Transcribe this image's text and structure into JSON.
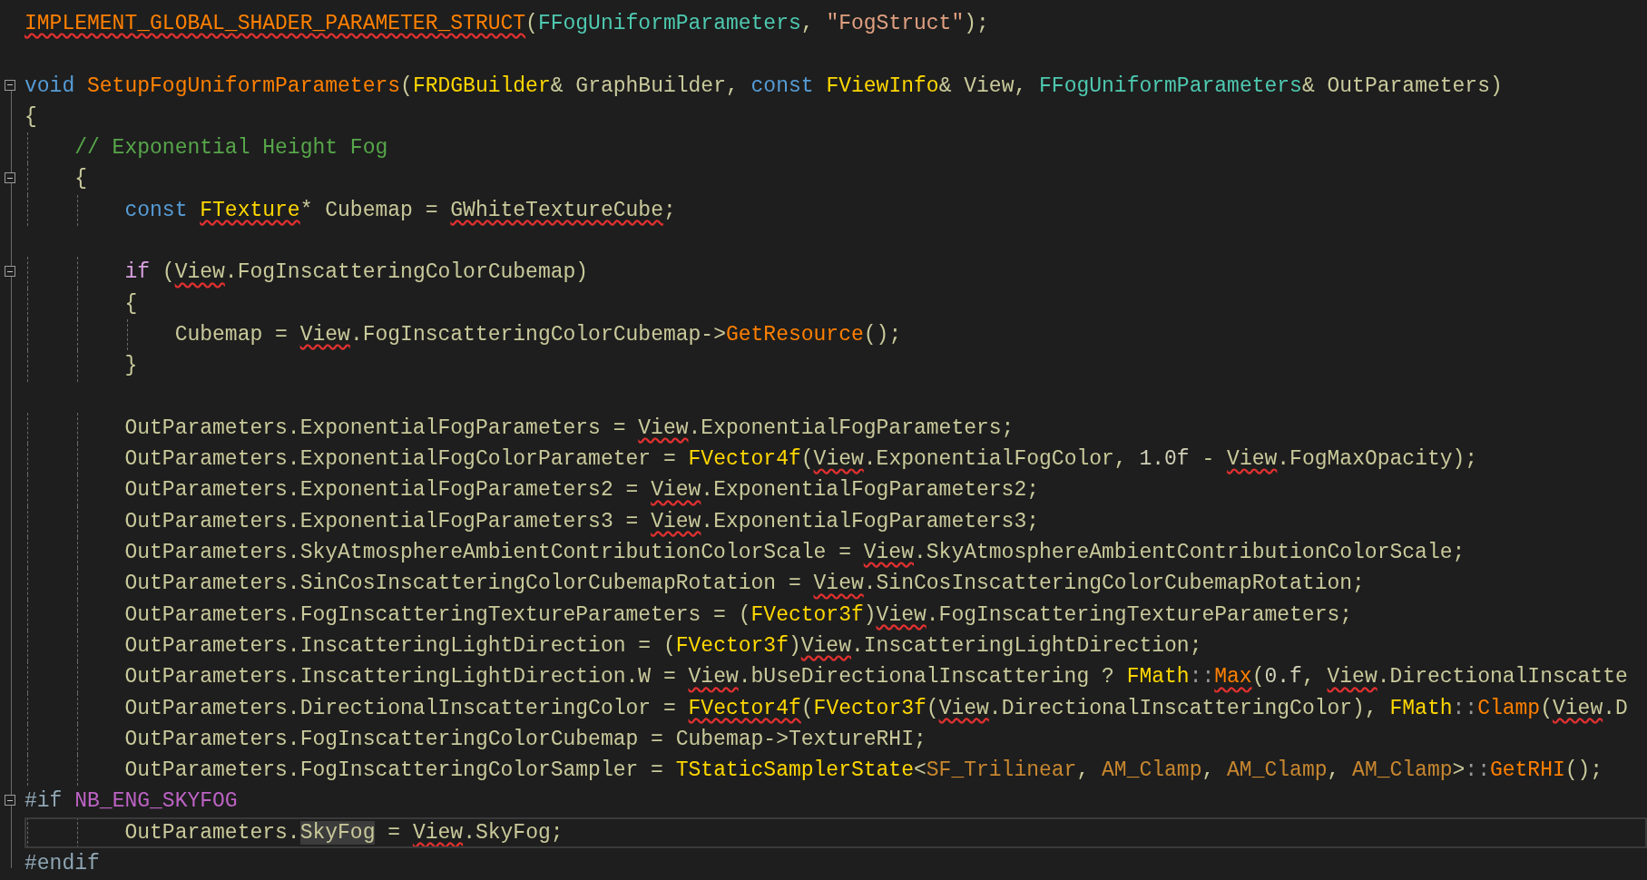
{
  "editor": {
    "lines": [
      {
        "fold": false,
        "current": false,
        "tokens": [
          {
            "text": "IMPLEMENT_GLOBAL_SHADER_PARAMETER_STRUCT",
            "kind": "fn",
            "squiggle": true,
            "highlighted": false
          },
          {
            "text": "(",
            "kind": "id",
            "squiggle": false,
            "highlighted": false
          },
          {
            "text": "FFogUniformParameters",
            "kind": "cls",
            "squiggle": false,
            "highlighted": false
          },
          {
            "text": ", ",
            "kind": "id",
            "squiggle": false,
            "highlighted": false
          },
          {
            "text": "\"FogStruct\"",
            "kind": "str",
            "squiggle": false,
            "highlighted": false
          },
          {
            "text": ");",
            "kind": "id",
            "squiggle": false,
            "highlighted": false
          }
        ]
      },
      {
        "fold": false,
        "current": false
      },
      {
        "fold": true,
        "current": false,
        "tokens": [
          {
            "text": "void ",
            "kind": "kw",
            "squiggle": false,
            "highlighted": false
          },
          {
            "text": "SetupFogUniformParameters",
            "kind": "fn",
            "squiggle": false,
            "highlighted": false
          },
          {
            "text": "(",
            "kind": "id",
            "squiggle": false,
            "highlighted": false
          },
          {
            "text": "FRDGBuilder",
            "kind": "type",
            "squiggle": false,
            "highlighted": false
          },
          {
            "text": "& GraphBuilder, ",
            "kind": "id",
            "squiggle": false,
            "highlighted": false
          },
          {
            "text": "const ",
            "kind": "kw",
            "squiggle": false,
            "highlighted": false
          },
          {
            "text": "FViewInfo",
            "kind": "type",
            "squiggle": false,
            "highlighted": false
          },
          {
            "text": "& View, ",
            "kind": "id",
            "squiggle": false,
            "highlighted": false
          },
          {
            "text": "FFogUniformParameters",
            "kind": "cls",
            "squiggle": false,
            "highlighted": false
          },
          {
            "text": "& OutParameters)",
            "kind": "id",
            "squiggle": false,
            "highlighted": false
          }
        ]
      },
      {
        "fold": false,
        "current": false,
        "tokens": [
          {
            "text": "{",
            "kind": "id",
            "squiggle": false,
            "highlighted": false
          }
        ]
      },
      {
        "fold": false,
        "current": false,
        "tokens": [
          {
            "text": "    // Exponential Height Fog",
            "kind": "cmt",
            "squiggle": false,
            "highlighted": false
          }
        ]
      },
      {
        "fold": true,
        "current": false,
        "tokens": [
          {
            "text": "    {",
            "kind": "id",
            "squiggle": false,
            "highlighted": false
          }
        ]
      },
      {
        "fold": false,
        "current": false,
        "tokens": [
          {
            "text": "        const ",
            "kind": "kw",
            "squiggle": false,
            "highlighted": false
          },
          {
            "text": "FTexture",
            "kind": "type",
            "squiggle": true,
            "highlighted": false
          },
          {
            "text": "* Cubemap = ",
            "kind": "id",
            "squiggle": false,
            "highlighted": false
          },
          {
            "text": "GWhiteTextureCube",
            "kind": "id",
            "squiggle": true,
            "highlighted": false
          },
          {
            "text": ";",
            "kind": "id",
            "squiggle": false,
            "highlighted": false
          }
        ]
      },
      {
        "fold": false,
        "current": false
      },
      {
        "fold": true,
        "current": false,
        "tokens": [
          {
            "text": "        if",
            "kind": "ctl",
            "squiggle": false,
            "highlighted": false
          },
          {
            "text": " (",
            "kind": "id",
            "squiggle": false,
            "highlighted": false
          },
          {
            "text": "View",
            "kind": "id",
            "squiggle": true,
            "highlighted": false
          },
          {
            "text": ".FogInscatteringColorCubemap)",
            "kind": "id",
            "squiggle": false,
            "highlighted": false
          }
        ]
      },
      {
        "fold": false,
        "current": false,
        "tokens": [
          {
            "text": "        {",
            "kind": "id",
            "squiggle": false,
            "highlighted": false
          }
        ]
      },
      {
        "fold": false,
        "current": false,
        "tokens": [
          {
            "text": "            Cubemap = ",
            "kind": "id",
            "squiggle": false,
            "highlighted": false
          },
          {
            "text": "View",
            "kind": "id",
            "squiggle": true,
            "highlighted": false
          },
          {
            "text": ".FogInscatteringColorCubemap->",
            "kind": "id",
            "squiggle": false,
            "highlighted": false
          },
          {
            "text": "GetResource",
            "kind": "fn",
            "squiggle": false,
            "highlighted": false
          },
          {
            "text": "();",
            "kind": "id",
            "squiggle": false,
            "highlighted": false
          }
        ]
      },
      {
        "fold": false,
        "current": false,
        "tokens": [
          {
            "text": "        }",
            "kind": "id",
            "squiggle": false,
            "highlighted": false
          }
        ]
      },
      {
        "fold": false,
        "current": false
      },
      {
        "fold": false,
        "current": false,
        "tokens": [
          {
            "text": "        OutParameters.ExponentialFogParameters = ",
            "kind": "id",
            "squiggle": false,
            "highlighted": false
          },
          {
            "text": "View",
            "kind": "id",
            "squiggle": true,
            "highlighted": false
          },
          {
            "text": ".ExponentialFogParameters;",
            "kind": "id",
            "squiggle": false,
            "highlighted": false
          }
        ]
      },
      {
        "fold": false,
        "current": false,
        "tokens": [
          {
            "text": "        OutParameters.ExponentialFogColorParameter = ",
            "kind": "id",
            "squiggle": false,
            "highlighted": false
          },
          {
            "text": "FVector4f",
            "kind": "type",
            "squiggle": false,
            "highlighted": false
          },
          {
            "text": "(",
            "kind": "id",
            "squiggle": false,
            "highlighted": false
          },
          {
            "text": "View",
            "kind": "id",
            "squiggle": true,
            "highlighted": false
          },
          {
            "text": ".ExponentialFogColor, ",
            "kind": "id",
            "squiggle": false,
            "highlighted": false
          },
          {
            "text": "1.0f",
            "kind": "num",
            "squiggle": false,
            "highlighted": false
          },
          {
            "text": " - ",
            "kind": "id",
            "squiggle": false,
            "highlighted": false
          },
          {
            "text": "View",
            "kind": "id",
            "squiggle": true,
            "highlighted": false
          },
          {
            "text": ".FogMaxOpacity);",
            "kind": "id",
            "squiggle": false,
            "highlighted": false
          }
        ]
      },
      {
        "fold": false,
        "current": false,
        "tokens": [
          {
            "text": "        OutParameters.ExponentialFogParameters2 = ",
            "kind": "id",
            "squiggle": false,
            "highlighted": false
          },
          {
            "text": "View",
            "kind": "id",
            "squiggle": true,
            "highlighted": false
          },
          {
            "text": ".ExponentialFogParameters2;",
            "kind": "id",
            "squiggle": false,
            "highlighted": false
          }
        ]
      },
      {
        "fold": false,
        "current": false,
        "tokens": [
          {
            "text": "        OutParameters.ExponentialFogParameters3 = ",
            "kind": "id",
            "squiggle": false,
            "highlighted": false
          },
          {
            "text": "View",
            "kind": "id",
            "squiggle": true,
            "highlighted": false
          },
          {
            "text": ".ExponentialFogParameters3;",
            "kind": "id",
            "squiggle": false,
            "highlighted": false
          }
        ]
      },
      {
        "fold": false,
        "current": false,
        "tokens": [
          {
            "text": "        OutParameters.SkyAtmosphereAmbientContributionColorScale = ",
            "kind": "id",
            "squiggle": false,
            "highlighted": false
          },
          {
            "text": "View",
            "kind": "id",
            "squiggle": true,
            "highlighted": false
          },
          {
            "text": ".SkyAtmosphereAmbientContributionColorScale;",
            "kind": "id",
            "squiggle": false,
            "highlighted": false
          }
        ]
      },
      {
        "fold": false,
        "current": false,
        "tokens": [
          {
            "text": "        OutParameters.SinCosInscatteringColorCubemapRotation = ",
            "kind": "id",
            "squiggle": false,
            "highlighted": false
          },
          {
            "text": "View",
            "kind": "id",
            "squiggle": true,
            "highlighted": false
          },
          {
            "text": ".SinCosInscatteringColorCubemapRotation;",
            "kind": "id",
            "squiggle": false,
            "highlighted": false
          }
        ]
      },
      {
        "fold": false,
        "current": false,
        "tokens": [
          {
            "text": "        OutParameters.FogInscatteringTextureParameters = (",
            "kind": "id",
            "squiggle": false,
            "highlighted": false
          },
          {
            "text": "FVector3f",
            "kind": "type",
            "squiggle": false,
            "highlighted": false
          },
          {
            "text": ")",
            "kind": "id",
            "squiggle": false,
            "highlighted": false
          },
          {
            "text": "View",
            "kind": "id",
            "squiggle": true,
            "highlighted": false
          },
          {
            "text": ".FogInscatteringTextureParameters;",
            "kind": "id",
            "squiggle": false,
            "highlighted": false
          }
        ]
      },
      {
        "fold": false,
        "current": false,
        "tokens": [
          {
            "text": "        OutParameters.InscatteringLightDirection = (",
            "kind": "id",
            "squiggle": false,
            "highlighted": false
          },
          {
            "text": "FVector3f",
            "kind": "type",
            "squiggle": false,
            "highlighted": false
          },
          {
            "text": ")",
            "kind": "id",
            "squiggle": false,
            "highlighted": false
          },
          {
            "text": "View",
            "kind": "id",
            "squiggle": true,
            "highlighted": false
          },
          {
            "text": ".InscatteringLightDirection;",
            "kind": "id",
            "squiggle": false,
            "highlighted": false
          }
        ]
      },
      {
        "fold": false,
        "current": false,
        "tokens": [
          {
            "text": "        OutParameters.InscatteringLightDirection.W = ",
            "kind": "id",
            "squiggle": false,
            "highlighted": false
          },
          {
            "text": "View",
            "kind": "id",
            "squiggle": true,
            "highlighted": false
          },
          {
            "text": ".bUseDirectionalInscattering ? ",
            "kind": "id",
            "squiggle": false,
            "highlighted": false
          },
          {
            "text": "FMath",
            "kind": "type",
            "squiggle": false,
            "highlighted": false
          },
          {
            "text": "::",
            "kind": "op",
            "squiggle": false,
            "highlighted": false
          },
          {
            "text": "Max",
            "kind": "fn",
            "squiggle": true,
            "highlighted": false
          },
          {
            "text": "(",
            "kind": "id",
            "squiggle": false,
            "highlighted": false
          },
          {
            "text": "0.f",
            "kind": "num",
            "squiggle": false,
            "highlighted": false
          },
          {
            "text": ", ",
            "kind": "id",
            "squiggle": false,
            "highlighted": false
          },
          {
            "text": "View",
            "kind": "id",
            "squiggle": true,
            "highlighted": false
          },
          {
            "text": ".DirectionalInscatte",
            "kind": "id",
            "squiggle": false,
            "highlighted": false
          }
        ]
      },
      {
        "fold": false,
        "current": false,
        "tokens": [
          {
            "text": "        OutParameters.DirectionalInscatteringColor = ",
            "kind": "id",
            "squiggle": false,
            "highlighted": false
          },
          {
            "text": "FVector4f",
            "kind": "type",
            "squiggle": true,
            "highlighted": false
          },
          {
            "text": "(",
            "kind": "id",
            "squiggle": false,
            "highlighted": false
          },
          {
            "text": "FVector3f",
            "kind": "type",
            "squiggle": false,
            "highlighted": false
          },
          {
            "text": "(",
            "kind": "id",
            "squiggle": false,
            "highlighted": false
          },
          {
            "text": "View",
            "kind": "id",
            "squiggle": true,
            "highlighted": false
          },
          {
            "text": ".DirectionalInscatteringColor), ",
            "kind": "id",
            "squiggle": false,
            "highlighted": false
          },
          {
            "text": "FMath",
            "kind": "type",
            "squiggle": false,
            "highlighted": false
          },
          {
            "text": "::",
            "kind": "op",
            "squiggle": false,
            "highlighted": false
          },
          {
            "text": "Clamp",
            "kind": "fn",
            "squiggle": false,
            "highlighted": false
          },
          {
            "text": "(",
            "kind": "id",
            "squiggle": false,
            "highlighted": false
          },
          {
            "text": "View",
            "kind": "id",
            "squiggle": true,
            "highlighted": false
          },
          {
            "text": ".D",
            "kind": "id",
            "squiggle": false,
            "highlighted": false
          }
        ]
      },
      {
        "fold": false,
        "current": false,
        "tokens": [
          {
            "text": "        OutParameters.FogInscatteringColorCubemap = Cubemap->TextureRHI;",
            "kind": "id",
            "squiggle": false,
            "highlighted": false
          }
        ]
      },
      {
        "fold": false,
        "current": false,
        "tokens": [
          {
            "text": "        OutParameters.FogInscatteringColorSampler = ",
            "kind": "id",
            "squiggle": false,
            "highlighted": false
          },
          {
            "text": "TStaticSamplerState",
            "kind": "type",
            "squiggle": false,
            "highlighted": false
          },
          {
            "text": "<",
            "kind": "id",
            "squiggle": false,
            "highlighted": false
          },
          {
            "text": "SF_Trilinear",
            "kind": "enum",
            "squiggle": false,
            "highlighted": false
          },
          {
            "text": ", ",
            "kind": "id",
            "squiggle": false,
            "highlighted": false
          },
          {
            "text": "AM_Clamp",
            "kind": "enum",
            "squiggle": false,
            "highlighted": false
          },
          {
            "text": ", ",
            "kind": "id",
            "squiggle": false,
            "highlighted": false
          },
          {
            "text": "AM_Clamp",
            "kind": "enum",
            "squiggle": false,
            "highlighted": false
          },
          {
            "text": ", ",
            "kind": "id",
            "squiggle": false,
            "highlighted": false
          },
          {
            "text": "AM_Clamp",
            "kind": "enum",
            "squiggle": false,
            "highlighted": false
          },
          {
            "text": ">",
            "kind": "id",
            "squiggle": false,
            "highlighted": false
          },
          {
            "text": "::",
            "kind": "op",
            "squiggle": false,
            "highlighted": false
          },
          {
            "text": "GetRHI",
            "kind": "fn",
            "squiggle": false,
            "highlighted": false
          },
          {
            "text": "();",
            "kind": "id",
            "squiggle": false,
            "highlighted": false
          }
        ]
      },
      {
        "fold": true,
        "current": false,
        "tokens": [
          {
            "text": "#if ",
            "kind": "pp",
            "squiggle": false,
            "highlighted": false
          },
          {
            "text": "NB_ENG_SKYFOG",
            "kind": "mac",
            "squiggle": false,
            "highlighted": false
          }
        ]
      },
      {
        "fold": false,
        "current": true,
        "tokens": [
          {
            "text": "        OutParameters.",
            "kind": "id",
            "squiggle": false,
            "highlighted": false
          },
          {
            "text": "SkyFog",
            "kind": "id",
            "squiggle": false,
            "highlighted": true
          },
          {
            "text": " = ",
            "kind": "id",
            "squiggle": false,
            "highlighted": false
          },
          {
            "text": "View",
            "kind": "id",
            "squiggle": true,
            "highlighted": false
          },
          {
            "text": ".SkyFog;",
            "kind": "id",
            "squiggle": false,
            "highlighted": false
          }
        ]
      },
      {
        "fold": false,
        "current": false,
        "tokens": [
          {
            "text": "#endif",
            "kind": "pp",
            "squiggle": false,
            "highlighted": false
          }
        ]
      }
    ]
  }
}
